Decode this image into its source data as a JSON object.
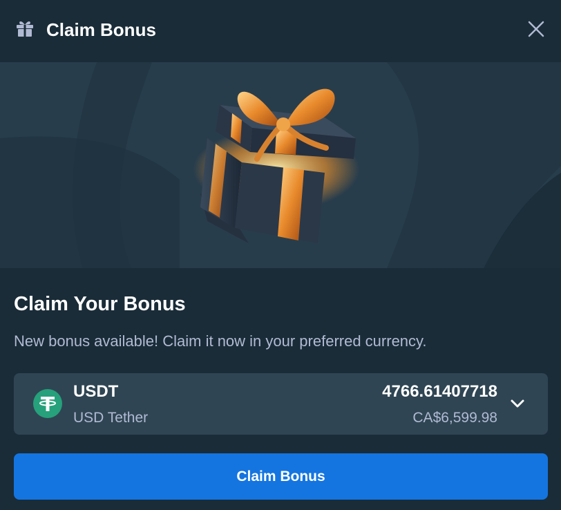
{
  "header": {
    "title": "Claim Bonus",
    "icon": "gift-icon",
    "close_icon": "close-icon"
  },
  "banner": {
    "image": "gift-box-illustration"
  },
  "content": {
    "title": "Claim Your Bonus",
    "description": "New bonus available! Claim it now in your preferred currency."
  },
  "currency": {
    "code": "USDT",
    "name": "USD Tether",
    "amount": "4766.61407718",
    "fiat": "CA$6,599.98",
    "icon": "tether-icon",
    "dropdown_icon": "chevron-down-icon"
  },
  "action": {
    "claim_label": "Claim Bonus"
  },
  "colors": {
    "background": "#1a2c38",
    "panel": "#2f4553",
    "banner": "#283d4c",
    "accent": "#1475e1",
    "tether": "#26a17b",
    "muted_text": "#b1bad3"
  }
}
